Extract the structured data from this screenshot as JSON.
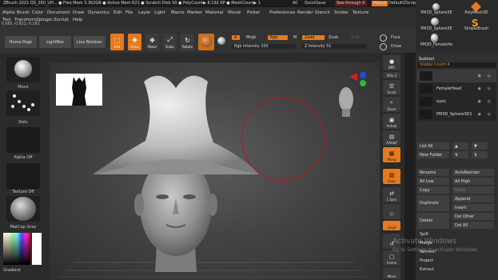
{
  "titlebar": {
    "text": "ZBrush 2021   QS_260_UH...  ● Free Mem 3.362GB ● Active Mem 621 ● Scratch Disk 50 ● PolyCount▶ 8.192 KP ● MeshCount▶ 1",
    "ac": "AC",
    "quicksave": "QuickSave",
    "see_through": "See-through  0",
    "menus": "Menus",
    "script": "DefaultZScript"
  },
  "menus": {
    "row1": [
      "Alpha",
      "Brush",
      "Color",
      "Document",
      "Draw",
      "Dynamics",
      "Edit",
      "File",
      "Layer",
      "Light",
      "Macro",
      "Marker",
      "Material",
      "Movie",
      "Picker",
      "Preferences",
      "Render",
      "Stencil",
      "Stroke",
      "Texture"
    ],
    "row2": [
      "Tool",
      "Transform",
      "Zplugin",
      "Zscript",
      "Help"
    ],
    "coords": "0.665,-0.822,-0.161"
  },
  "presets": [
    {
      "label": "PM3D_Sphere3E"
    },
    {
      "label": "PolyMesh3D"
    },
    {
      "label": "PM3D_Sphere3E"
    },
    {
      "label": "SimpleBrush"
    },
    {
      "label": "PM3D_FemaleHe"
    }
  ],
  "shelf": {
    "home_page": "Home Page",
    "lightbox": "LightBox",
    "live_boolean": "Live Boolean",
    "edit": "Edit",
    "draw": "Draw",
    "move": "Move",
    "scale": "Scale",
    "rotate": "Rotate",
    "a": "A",
    "mrgb": "Mrgb",
    "rgb": "Rgb",
    "m": "M",
    "zadd": "Zadd",
    "zsub": "Zsub",
    "zcut": "Zcut",
    "rgb_intensity": "Rgb Intensity 100",
    "z_intensity": "Z Intensity 51",
    "focal_shift": "Focal Shift 0",
    "draw_size": "Draw Size 64",
    "focal_short": "Foca",
    "draw_short": "Draw"
  },
  "left": {
    "move": "Move",
    "dots": "Dots",
    "alpha_off": "Alpha Off",
    "texture_off": "Texture Off",
    "matcap": "MatCap Gray",
    "gradient": "Gradient"
  },
  "righttools": {
    "bpr": "BPR",
    "spix": "SPix 3",
    "scroll": "Scroll",
    "zoom": "Zoom",
    "actual": "Actual",
    "aahalf": "AAHalf",
    "persp": "Persp",
    "floor": "Floor",
    "lsym": "L.Sym",
    "xyz": "Gxyz",
    "frame": "Frame",
    "move": "Move"
  },
  "subtool": {
    "header": "Subtool",
    "visible_count": "Visible Count 4",
    "items": [
      {
        "name": ""
      },
      {
        "name": "FemaleHead"
      },
      {
        "name": "eyes"
      },
      {
        "name": "PM3D_Sphere3D1"
      }
    ],
    "list_all": "List All",
    "new_folder": "New Folder",
    "rename": "Rename",
    "autoreorder": "AutoReorder",
    "all_low": "All Low",
    "all_high": "All High",
    "copy": "Copy",
    "paste": "Paste",
    "duplicate": "Duplicate",
    "append": "Append",
    "insert": "Insert",
    "delete": "Delete",
    "del_other": "Del Other",
    "del_all": "Del All",
    "split": "Split",
    "merge": "Merge",
    "remesh": "Remesh",
    "project": "Project",
    "extract": "Extract"
  },
  "watermark": {
    "line1": "Activate Windows",
    "line2": "Go to Settings to activate Windows."
  },
  "colors": {
    "accent": "#e7791c",
    "brush_circle": "#b8161c",
    "bg": "#2b2b2b"
  }
}
